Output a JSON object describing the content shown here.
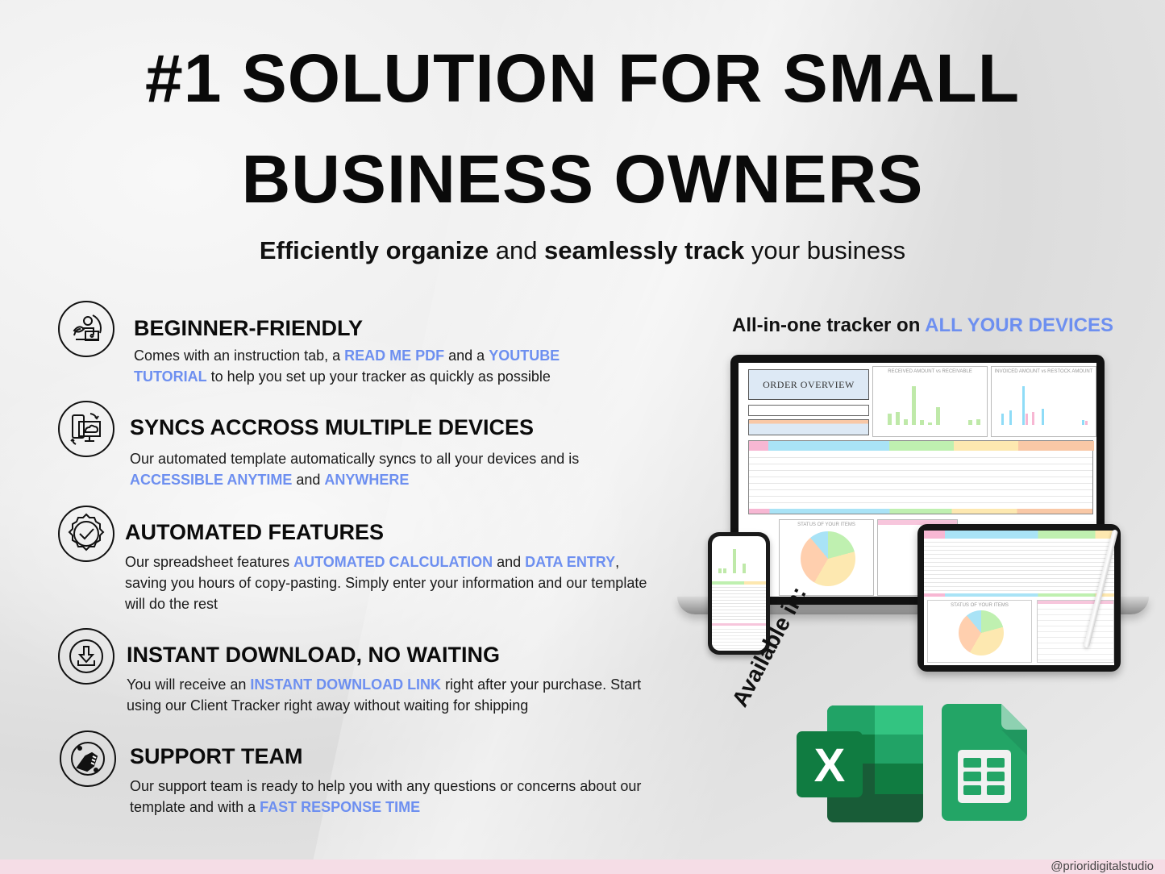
{
  "header": {
    "title_line1": "#1 SOLUTION FOR SMALL",
    "title_line2": "BUSINESS OWNERS",
    "subtitle_parts": [
      "Efficiently organize",
      " and ",
      "seamlessly track",
      " your business"
    ]
  },
  "features": [
    {
      "icon": "person-laptop-leaf-icon",
      "title": "BEGINNER-FRIENDLY",
      "desc": [
        {
          "t": "Comes with an instruction tab, a ",
          "hl": false
        },
        {
          "t": "READ ME PDF",
          "hl": true
        },
        {
          "t": " and a ",
          "hl": false
        },
        {
          "t": "YOUTUBE TUTORIAL",
          "hl": true
        },
        {
          "t": " to help you set up your tracker as quickly as possible",
          "hl": false
        }
      ]
    },
    {
      "icon": "devices-sync-icon",
      "title": "SYNCS ACCROSS MULTIPLE DEVICES",
      "desc": [
        {
          "t": "Our automated template automatically syncs to all your devices and is ",
          "hl": false
        },
        {
          "t": "ACCESSIBLE ANYTIME",
          "hl": true
        },
        {
          "t": " and ",
          "hl": false
        },
        {
          "t": "ANYWHERE",
          "hl": true
        }
      ]
    },
    {
      "icon": "gear-check-icon",
      "title": "AUTOMATED FEATURES",
      "desc": [
        {
          "t": "Our spreadsheet features ",
          "hl": false
        },
        {
          "t": "AUTOMATED CALCULATION",
          "hl": true
        },
        {
          "t": " and ",
          "hl": false
        },
        {
          "t": "DATA ENTRY",
          "hl": true
        },
        {
          "t": ", saving you hours of copy-pasting. Simply enter your information and our template will do the rest",
          "hl": false
        }
      ]
    },
    {
      "icon": "download-icon",
      "title": "INSTANT DOWNLOAD, NO WAITING",
      "desc": [
        {
          "t": "You will receive an ",
          "hl": false
        },
        {
          "t": "INSTANT DOWNLOAD LINK",
          "hl": true
        },
        {
          "t": " right after your purchase. Start using our Client Tracker right away without waiting for shipping",
          "hl": false
        }
      ]
    },
    {
      "icon": "handshake-support-icon",
      "title": "SUPPORT TEAM",
      "desc": [
        {
          "t": "Our support team is ready to help you with any questions or concerns about our template and with a ",
          "hl": false
        },
        {
          "t": "FAST RESPONSE TIME",
          "hl": true
        }
      ]
    }
  ],
  "devices": {
    "title_plain": "All-in-one tracker on ",
    "title_highlight": "ALL YOUR DEVICES",
    "screen": {
      "overview_title": "ORDER OVERVIEW",
      "chart1_title": "RECEIVED AMOUNT vs RECEIVABLE",
      "chart2_title": "INVOICED AMOUNT vs RESTOCK AMOUNT",
      "pie_title": "STATUS OF YOUR ITEMS"
    }
  },
  "availability": {
    "label": "Available in:",
    "apps": [
      "Microsoft Excel",
      "Google Sheets"
    ]
  },
  "footer": {
    "handle": "@prioridigitalstudio"
  },
  "colors": {
    "highlight": "#6d8ff0",
    "footer_bg": "#f5dde6",
    "excel_green": "#107c41",
    "sheets_green": "#23a566"
  }
}
